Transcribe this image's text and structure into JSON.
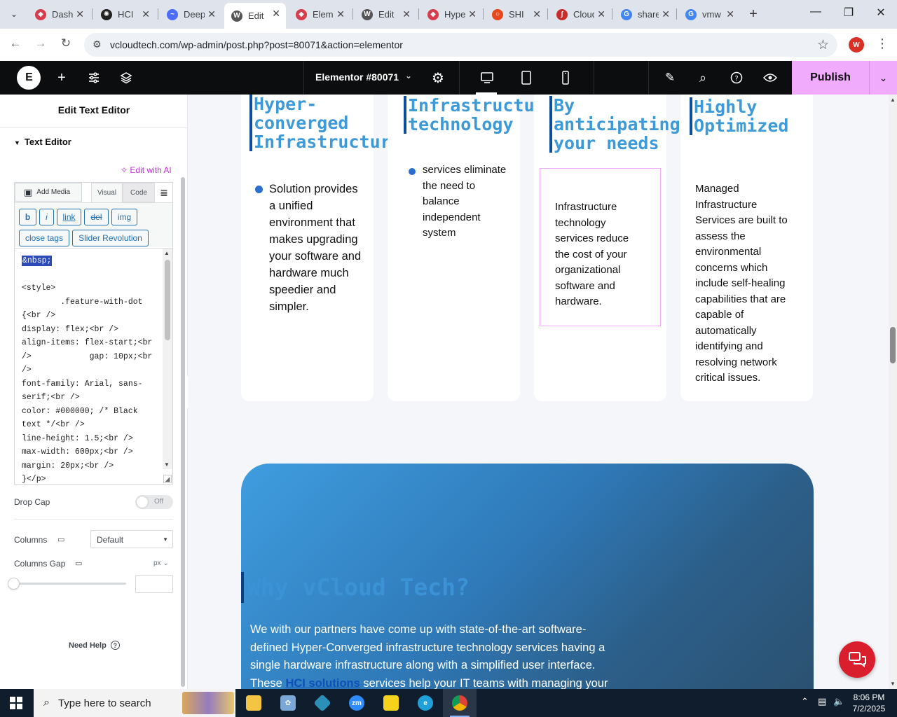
{
  "browser": {
    "tabs": [
      {
        "label": "Dashboard",
        "icon": "elementor-icon",
        "color": "#d63c4b"
      },
      {
        "label": "HCI",
        "icon": "openai-icon",
        "color": "#222222"
      },
      {
        "label": "DeepSeek",
        "icon": "deepseek-icon",
        "color": "#4d6bfe"
      },
      {
        "label": "Edit",
        "icon": "wordpress-icon",
        "color": "#555555"
      },
      {
        "label": "Elementor",
        "icon": "elementor-icon",
        "color": "#d63c4b"
      },
      {
        "label": "Edit",
        "icon": "wordpress-icon",
        "color": "#555555"
      },
      {
        "label": "Hyper",
        "icon": "elementor-icon",
        "color": "#d63c4b"
      },
      {
        "label": "SHI",
        "icon": "ring-icon",
        "color": "#e6471d"
      },
      {
        "label": "Cloud",
        "icon": "swirl-icon",
        "color": "#c92a2a"
      },
      {
        "label": "share",
        "icon": "google-icon",
        "color": "#4285f4"
      },
      {
        "label": "vmw",
        "icon": "google-icon",
        "color": "#4285f4"
      }
    ],
    "active_tab": 3,
    "url": "vcloudtech.com/wp-admin/post.php?post=80071&action=elementor",
    "profile_initial": "W"
  },
  "elementor": {
    "document_title": "Elementor #80071",
    "publish_label": "Publish"
  },
  "panel": {
    "title": "Edit Text Editor",
    "section": "Text Editor",
    "ai_link": "Edit with AI",
    "add_media": "Add Media",
    "tab_visual": "Visual",
    "tab_code": "Code",
    "quicktags": [
      "b",
      "i",
      "link",
      "del",
      "img",
      "close tags",
      "Slider Revolution"
    ],
    "code_selected": "&nbsp;",
    "code_lines": "\n\n<style>\n        .feature-with-dot {<br />\ndisplay: flex;<br />\nalign-items: flex-start;<br />            gap: 10px;<br />\nfont-family: Arial, sans-serif;<br />\ncolor: #000000; /* Black text */<br />\nline-height: 1.5;<br />\nmax-width: 600px;<br />\nmargin: 20px;<br />\n}</p>",
    "drop_cap_label": "Drop Cap",
    "drop_cap_state": "Off",
    "columns_label": "Columns",
    "columns_value": "Default",
    "columns_gap_label": "Columns Gap",
    "columns_gap_unit": "px",
    "need_help": "Need Help"
  },
  "preview": {
    "cards": [
      {
        "title_lines": [
          "Hyper-",
          "converged",
          "Infrastructure"
        ],
        "bullet": "Solution provides a unified environment that makes upgrading your software and hardware much speedier and simpler."
      },
      {
        "title_lines": [
          "Infrastructure",
          "technology"
        ],
        "bullet": "services eliminate the need to balance independent system"
      },
      {
        "title_lines": [
          "By",
          "anticipating",
          "your needs"
        ],
        "body": "Infrastructure technology services reduce the cost of your organizational software and hardware."
      },
      {
        "title_lines": [
          "Highly",
          "Optimized"
        ],
        "body": "Managed Infrastructure Services are built to assess the environmental concerns which include self-healing capabilities that are capable of automatically identifying and resolving network critical issues."
      }
    ],
    "banner_title": "Why vCloud Tech?",
    "banner_text_before": "We with our partners have come up with state-of-the-art software-defined Hyper-Converged infrastructure technology services having a single hardware infrastructure along with a simplified user interface. These ",
    "banner_link": "HCI solutions",
    "banner_text_after": " services help your IT teams with managing your organizational"
  },
  "taskbar": {
    "search_placeholder": "Type here to search",
    "time": "8:06 PM",
    "date": "7/2/2025"
  },
  "colors": {
    "elementor_dark": "#0c0d0e",
    "publish_pink": "#f0abfc",
    "heading_blue": "#3d9ad9",
    "accent_blue": "#2271b1",
    "chat_red": "#d91e2e"
  }
}
